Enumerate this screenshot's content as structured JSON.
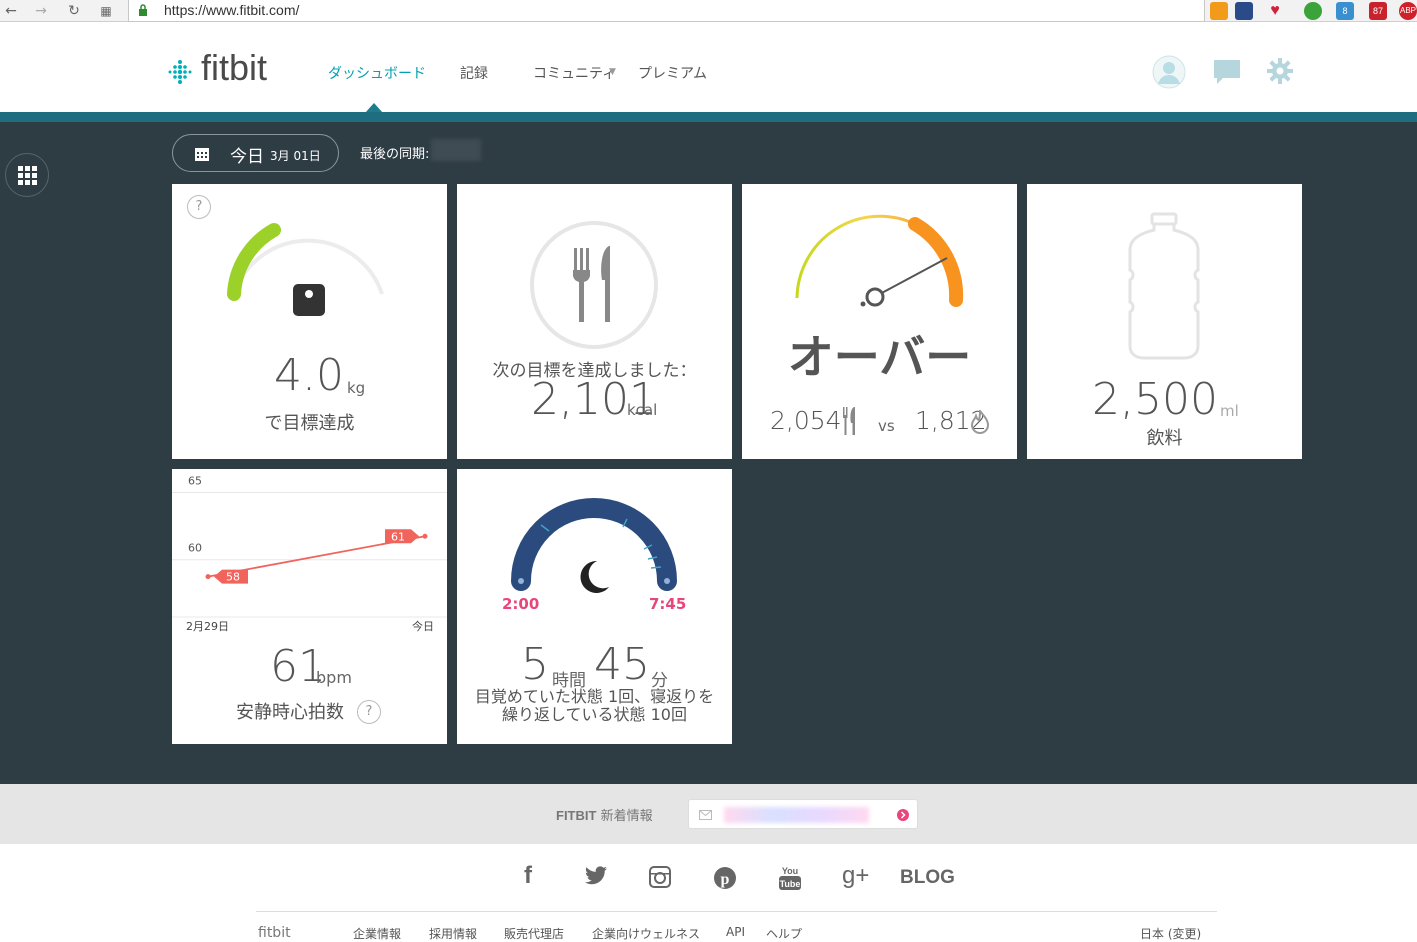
{
  "browser": {
    "url": "https://www.fitbit.com/",
    "ext_badges": [
      "8",
      "87",
      "ABP"
    ]
  },
  "header": {
    "logo": "fitbit",
    "nav": [
      {
        "label": "ダッシュボード"
      },
      {
        "label": "記録"
      },
      {
        "label": "コミュニティ"
      },
      {
        "label": "プレミアム"
      }
    ]
  },
  "toolbar": {
    "today_label": "今日",
    "date": "3月 01日",
    "last_sync_label": "最後の同期:"
  },
  "tiles": {
    "weight": {
      "value": "4.0",
      "unit": "kg",
      "caption": "で目標達成",
      "help": "?"
    },
    "food": {
      "caption": "次の目標を達成しました：",
      "value": "2,101",
      "unit": "kcal"
    },
    "calories": {
      "status": "オーバー",
      "in": "2,054",
      "vs": "vs",
      "out": "1,812"
    },
    "water": {
      "value": "2,500",
      "unit": "ml",
      "caption": "飲料"
    },
    "heart": {
      "y_ticks": [
        "65",
        "60"
      ],
      "x_start": "2月29日",
      "x_end": "今日",
      "value": "61",
      "unit": "bpm",
      "caption": "安静時心拍数",
      "help": "?"
    },
    "sleep": {
      "start": "2:00",
      "end": "7:45",
      "hours": "5",
      "hours_unit": "時間",
      "minutes": "45",
      "minutes_unit": "分",
      "caption_line1": "目覚めていた状態 1回、寝返りを",
      "caption_line2": "繰り返している状態 10回"
    }
  },
  "chart_data": {
    "type": "line",
    "x": [
      "2月29日",
      "今日"
    ],
    "series": [
      {
        "values": [
          58,
          61
        ]
      }
    ],
    "ylim": [
      55,
      66
    ],
    "y_ticks": [
      65,
      60
    ]
  },
  "footer": {
    "news_brand": "FITBIT",
    "news_label": "新着情報",
    "blog": "BLOG",
    "links": [
      "企業情報",
      "採用情報",
      "販売代理店",
      "企業向けウェルネス",
      "API",
      "ヘルプ"
    ],
    "lang": "日本 (変更)"
  },
  "colors": {
    "teal": "#00a0b0",
    "dark_bg": "#2e3c44",
    "green": "#9ccc1e",
    "orange": "#f7931e",
    "coral": "#f0645c",
    "pink": "#e8457e",
    "sleep_blue": "#2b4b7e"
  }
}
